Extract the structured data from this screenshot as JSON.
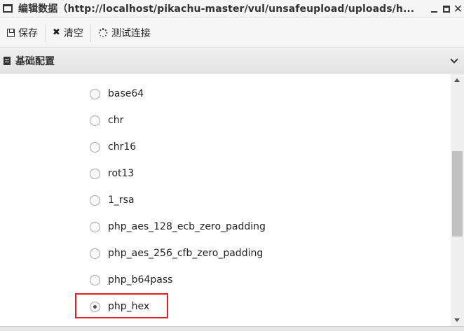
{
  "window": {
    "title": "编辑数据（http://localhost/pikachu-master/vul/unsafeupload/uploads/h...",
    "minimize_glyph": "_",
    "close_glyph": "✕"
  },
  "toolbar": {
    "save_label": "保存",
    "clear_label": "清空",
    "test_label": "测试连接"
  },
  "section": {
    "title": "基础配置",
    "expanded": true
  },
  "encoders": {
    "options": [
      "base64",
      "chr",
      "chr16",
      "rot13",
      "1_rsa",
      "php_aes_128_ecb_zero_padding",
      "php_aes_256_cfb_zero_padding",
      "php_b64pass",
      "php_hex"
    ],
    "selected": "php_hex"
  },
  "colors": {
    "highlight": "#e02020"
  }
}
